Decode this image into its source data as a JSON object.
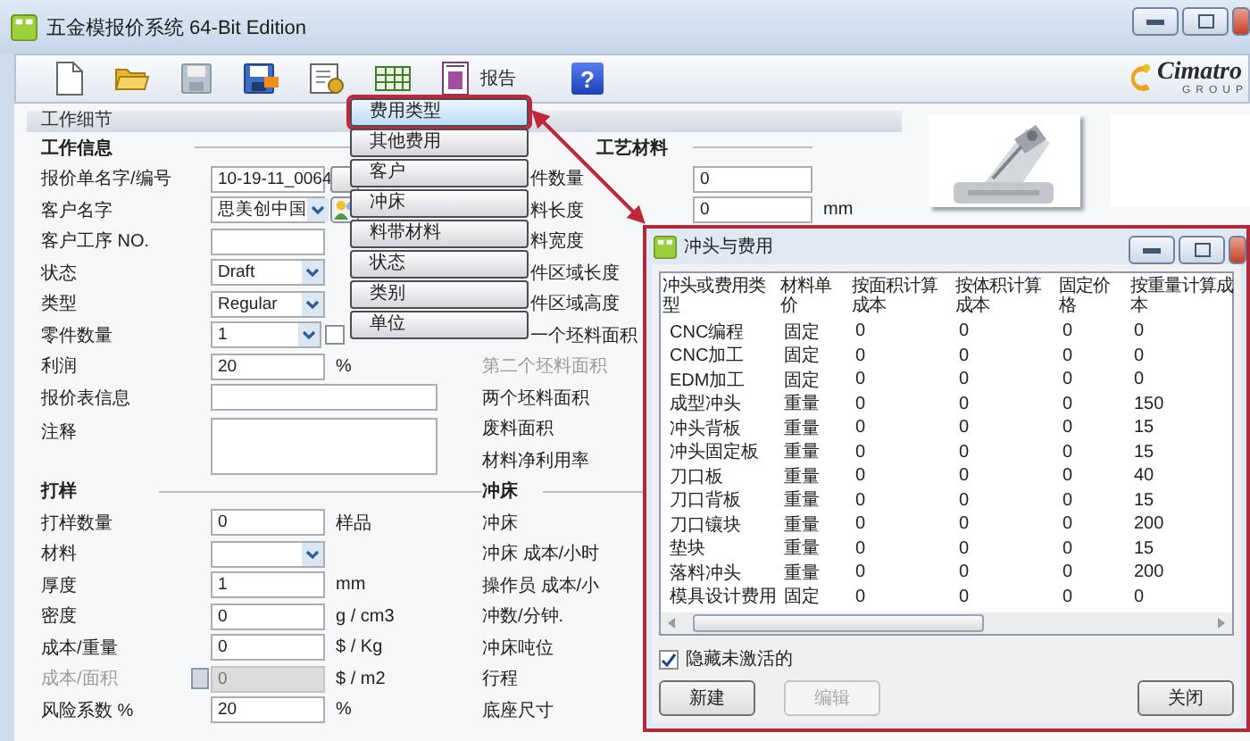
{
  "window": {
    "title": "五金模报价系统 64-Bit Edition"
  },
  "toolbar": {
    "report_label": "报告",
    "help_glyph": "?",
    "logo_name": "Cimatro",
    "logo_sub": "GROUP"
  },
  "menu": {
    "items": [
      {
        "label": "费用类型",
        "selected": true
      },
      {
        "label": "其他费用",
        "selected": false
      },
      {
        "label": "客户",
        "selected": false
      },
      {
        "label": "冲床",
        "selected": false
      },
      {
        "label": "料带材料",
        "selected": false
      },
      {
        "label": "状态",
        "selected": false
      },
      {
        "label": "类别",
        "selected": false
      },
      {
        "label": "单位",
        "selected": false
      }
    ]
  },
  "form": {
    "header": "工作细节",
    "left_rows": [
      {
        "kind": "section",
        "label": "工作信息"
      },
      {
        "kind": "text_button",
        "label": "报价单名字/编号",
        "value": "10-19-11_0064",
        "disabled": false
      },
      {
        "kind": "combo_people",
        "label": "客户名字",
        "value": "思美创中国",
        "disabled": false
      },
      {
        "kind": "text",
        "label": "客户工序 NO.",
        "disabled": false
      },
      {
        "kind": "combo",
        "label": "状态",
        "value": "Draft",
        "disabled": false
      },
      {
        "kind": "combo",
        "label": "类型",
        "value": "Regular",
        "disabled": false
      },
      {
        "kind": "combo_check",
        "label": "零件数量",
        "value": "1",
        "disabled": false,
        "checked": false
      },
      {
        "kind": "text",
        "label": "利润",
        "value": "20",
        "unit": "%",
        "disabled": false
      },
      {
        "kind": "wide",
        "label": "报价表信息",
        "disabled": false
      },
      {
        "kind": "textarea",
        "label": "注释",
        "disabled": false
      },
      {
        "kind": "section",
        "label": "打样"
      },
      {
        "kind": "text",
        "label": "打样数量",
        "value": "0",
        "unit": "样品",
        "disabled": false
      },
      {
        "kind": "combo",
        "label": "材料",
        "disabled": false
      },
      {
        "kind": "text",
        "label": "厚度",
        "value": "1",
        "unit": "mm",
        "disabled": false
      },
      {
        "kind": "text",
        "label": "密度",
        "value": "0",
        "unit": "g / cm3",
        "disabled": false
      },
      {
        "kind": "text",
        "label": "成本/重量",
        "value": "0",
        "unit": "$ / Kg",
        "disabled": false
      },
      {
        "kind": "text_lock",
        "label": "成本/面积",
        "value": "0",
        "unit": "$ / m2",
        "disabled": true
      },
      {
        "kind": "text",
        "label": "风险系数 %",
        "value": "20",
        "unit": "%",
        "disabled": false
      }
    ],
    "middle_rows": [
      {
        "kind": "section",
        "label": "工艺材料"
      },
      {
        "kind": "field",
        "label": "件数量",
        "value": "0",
        "disabled": false
      },
      {
        "kind": "field",
        "label": "料长度",
        "value": "0",
        "unit": "mm",
        "disabled": false
      },
      {
        "kind": "label",
        "label": "料宽度",
        "disabled": false
      },
      {
        "kind": "label",
        "label": "件区域长度",
        "disabled": false
      },
      {
        "kind": "label",
        "label": "件区域高度",
        "disabled": false
      },
      {
        "kind": "label",
        "label": "一个坯料面积",
        "disabled": false
      },
      {
        "kind": "label",
        "label": "第二个坯料面积",
        "disabled": true
      },
      {
        "kind": "label",
        "label": "两个坯料面积",
        "disabled": false
      },
      {
        "kind": "label",
        "label": "废料面积",
        "disabled": false
      },
      {
        "kind": "label",
        "label": "材料净利用率",
        "disabled": false
      },
      {
        "kind": "section",
        "label": "冲床"
      },
      {
        "kind": "label",
        "label": "冲床",
        "disabled": false
      },
      {
        "kind": "label",
        "label": "冲床 成本/小时",
        "disabled": false
      },
      {
        "kind": "label",
        "label": "操作员 成本/小",
        "disabled": false
      },
      {
        "kind": "label",
        "label": "冲数/分钟.",
        "disabled": false
      },
      {
        "kind": "label",
        "label": "冲床吨位",
        "disabled": false
      },
      {
        "kind": "label",
        "label": "行程",
        "disabled": false
      },
      {
        "kind": "label",
        "label": "底座尺寸",
        "disabled": false
      }
    ]
  },
  "dialog": {
    "title": "冲头与费用",
    "columns": [
      "冲头或费用类型",
      "材料单价",
      "按面积计算成本",
      "按体积计算成本",
      "固定价格",
      "按重量计算成本"
    ],
    "rows": [
      [
        "CNC编程",
        "固定",
        "0",
        "0",
        "0",
        "0"
      ],
      [
        "CNC加工",
        "固定",
        "0",
        "0",
        "0",
        "0"
      ],
      [
        "EDM加工",
        "固定",
        "0",
        "0",
        "0",
        "0"
      ],
      [
        "成型冲头",
        "重量",
        "0",
        "0",
        "0",
        "150"
      ],
      [
        "冲头背板",
        "重量",
        "0",
        "0",
        "0",
        "15"
      ],
      [
        "冲头固定板",
        "重量",
        "0",
        "0",
        "0",
        "15"
      ],
      [
        "刀口板",
        "重量",
        "0",
        "0",
        "0",
        "40"
      ],
      [
        "刀口背板",
        "重量",
        "0",
        "0",
        "0",
        "15"
      ],
      [
        "刀口镶块",
        "重量",
        "0",
        "0",
        "0",
        "200"
      ],
      [
        "垫块",
        "重量",
        "0",
        "0",
        "0",
        "15"
      ],
      [
        "落料冲头",
        "重量",
        "0",
        "0",
        "0",
        "200"
      ],
      [
        "模具设计费用",
        "固定",
        "0",
        "0",
        "0",
        "0"
      ]
    ],
    "hide_inactive": {
      "label": "隐藏未激活的",
      "checked": true
    },
    "buttons": [
      {
        "label": "新建",
        "disabled": false
      },
      {
        "label": "编辑",
        "disabled": true
      },
      {
        "label": "关闭",
        "disabled": false
      }
    ]
  }
}
